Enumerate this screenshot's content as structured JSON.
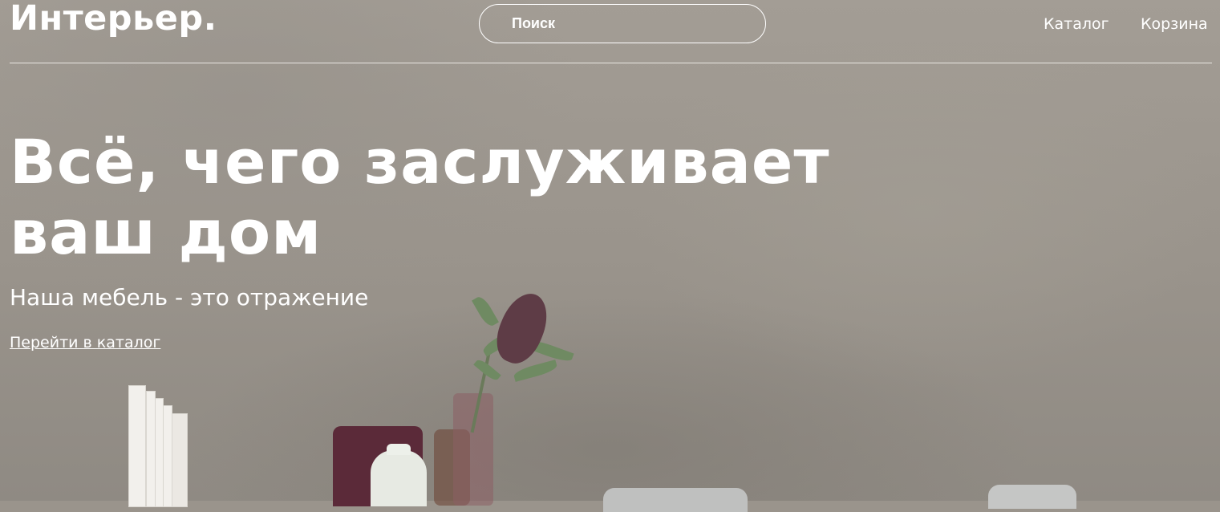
{
  "header": {
    "logo": "Интерьер.",
    "search": {
      "label": "Поиск"
    },
    "nav": {
      "catalog": "Каталог",
      "cart": "Корзина"
    }
  },
  "hero": {
    "headline_line1": "Всё, чего заслуживает",
    "headline_line2": "ваш дом",
    "subtitle": "Наша мебель - это отражение",
    "cta": "Перейти в каталог"
  }
}
